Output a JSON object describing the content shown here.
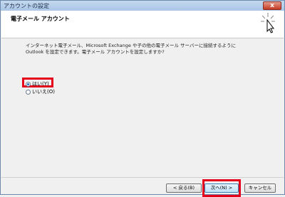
{
  "window": {
    "title": "アカウントの設定",
    "close_label": "x"
  },
  "header": {
    "title": "電子メール アカウント"
  },
  "body": {
    "description_line1": "インターネット電子メール、Microsoft Exchange や子の他の電子メール サーバーに接続するように",
    "description_line2": "Outlook を設定できます。電子メール アカウントを設定しますか?",
    "options": [
      {
        "label": "はい(Y)",
        "selected": true
      },
      {
        "label": "いいえ(O)",
        "selected": false
      }
    ]
  },
  "buttons": {
    "back": "< 戻る(B)",
    "next": "次へ(N) >",
    "cancel": "キャンセル"
  },
  "colors": {
    "highlight": "#e4001b",
    "titlebar": "#a9c5e6",
    "radio_dot": "#1f6ec6"
  }
}
